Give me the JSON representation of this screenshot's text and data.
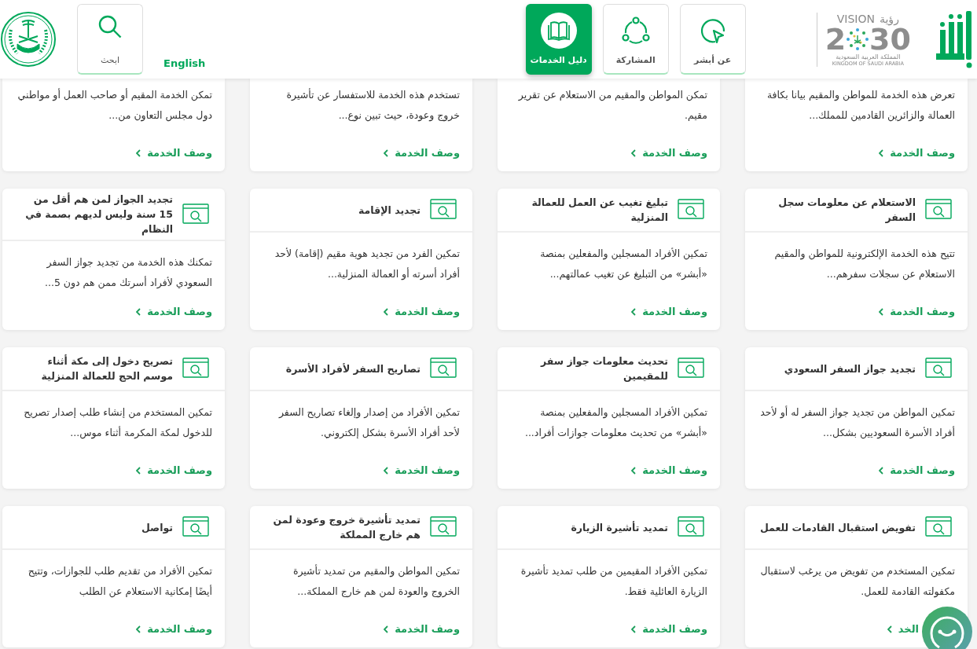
{
  "header": {
    "vision_logo": {
      "arabic": "رؤية",
      "latin": "VISION",
      "year_start": "2",
      "year_end": "30",
      "country_arabic": "المملكة العربية السعودية",
      "country_english": "KINGDOM OF SAUDI ARABIA"
    },
    "nav": [
      {
        "label": "عن أبشر",
        "kind": "pointer",
        "selected": false
      },
      {
        "label": "المشاركة",
        "kind": "share",
        "selected": false
      },
      {
        "label": "دليل الخدمات",
        "kind": "book",
        "selected": true
      }
    ],
    "language_link": "English",
    "search": {
      "label": "ابحث"
    }
  },
  "services": [
    {
      "description": "تعرض هذه الخدمة للمواطن والمقيم بيانا بكافة العمالة والزائرين القادمين للمملك...",
      "link": "وصف الخدمة"
    },
    {
      "description": "تمكن المواطن والمقيم من الاستعلام عن تقرير مقيم.",
      "link": "وصف الخدمة"
    },
    {
      "description": "تستخدم هذه الخدمة للاستفسار عن تأشيرة خروج وعودة، حيث تبين نوع...",
      "link": "وصف الخدمة"
    },
    {
      "description": "تمكن الخدمة المقيم أو صاحب العمل أو مواطني دول مجلس التعاون من...",
      "link": "وصف الخدمة"
    },
    {
      "title": "الاستعلام عن معلومات سجل السفر",
      "description": "تتيح هذه الخدمة الإلكترونية للمواطن والمقيم الاستعلام عن سجلات سفرهم...",
      "link": "وصف الخدمة"
    },
    {
      "title": "تبليغ تغيب عن العمل للعمالة المنزلية",
      "description": "تمكين الأفراد المسجلين والمفعلين بمنصة «أبشر» من التبليغ عن تغيب عمالتهم...",
      "link": "وصف الخدمة"
    },
    {
      "title": "تجديد الإقامة",
      "description": "تمكين الفرد من تجديد هوية مقيم (إقامة) لأحد أفراد أسرته أو العمالة المنزلية...",
      "link": "وصف الخدمة"
    },
    {
      "title": "تجديد الجواز لمن هم أقل من 15 سنة وليس لديهم بصمة في النظام",
      "description": "تمكنك هذه الخدمة من تجديد جواز السفر السعودي لأفراد أسرتك ممن هم دون 5...",
      "link": "وصف الخدمة"
    },
    {
      "title": "تجديد جواز السفر السعودي",
      "description": "تمكين المواطن من تجديد جواز السفر له أو لأحد أفراد الأسرة السعوديين بشكل...",
      "link": "وصف الخدمة"
    },
    {
      "title": "تحديث معلومات جواز سفر للمقيمين",
      "description": "تمكين الأفراد المسجلين والمفعلين بمنصة «أبشر» من تحديث معلومات جوازات أفراد...",
      "link": "وصف الخدمة"
    },
    {
      "title": "تصاريح السفر لأفراد الأسرة",
      "description": "تمكين الأفراد من إصدار وإلغاء تصاريح السفر لأحد أفراد الأسرة بشكل إلكتروني.",
      "link": "وصف الخدمة"
    },
    {
      "title": "تصريح دخول إلى مكة أثناء موسم الحج للعمالة المنزلية",
      "description": "تمكين المستخدم من إنشاء طلب إصدار تصريح للدخول لمكة المكرمة أثناء موس...",
      "link": "وصف الخدمة"
    },
    {
      "title": "تفويض استقبال القادمات للعمل",
      "description": "تمكين المستخدم من تفويض من يرغب لاستقبال مكفولته القادمة للعمل.",
      "link": "الخد",
      "overlaid": true
    },
    {
      "title": "تمديد تأشيرة الزيارة",
      "description": "تمكين الأفراد المقيمين من طلب تمديد تأشيرة الزيارة العائلية فقط.",
      "link": "وصف الخدمة"
    },
    {
      "title": "تمديد تأشيرة خروج وعودة لمن هم خارج المملكة",
      "description": "تمكين المواطن والمقيم من تمديد تأشيرة الخروج والعودة لمن هم خارج المملكة...",
      "link": "وصف الخدمة"
    },
    {
      "title": "تواصل",
      "description": "تمكين الأفراد من تقديم طلب للجوازات، وتتيح أيضًا إمكانية الاستعلام عن الطلب",
      "link": "وصف الخدمة"
    }
  ]
}
